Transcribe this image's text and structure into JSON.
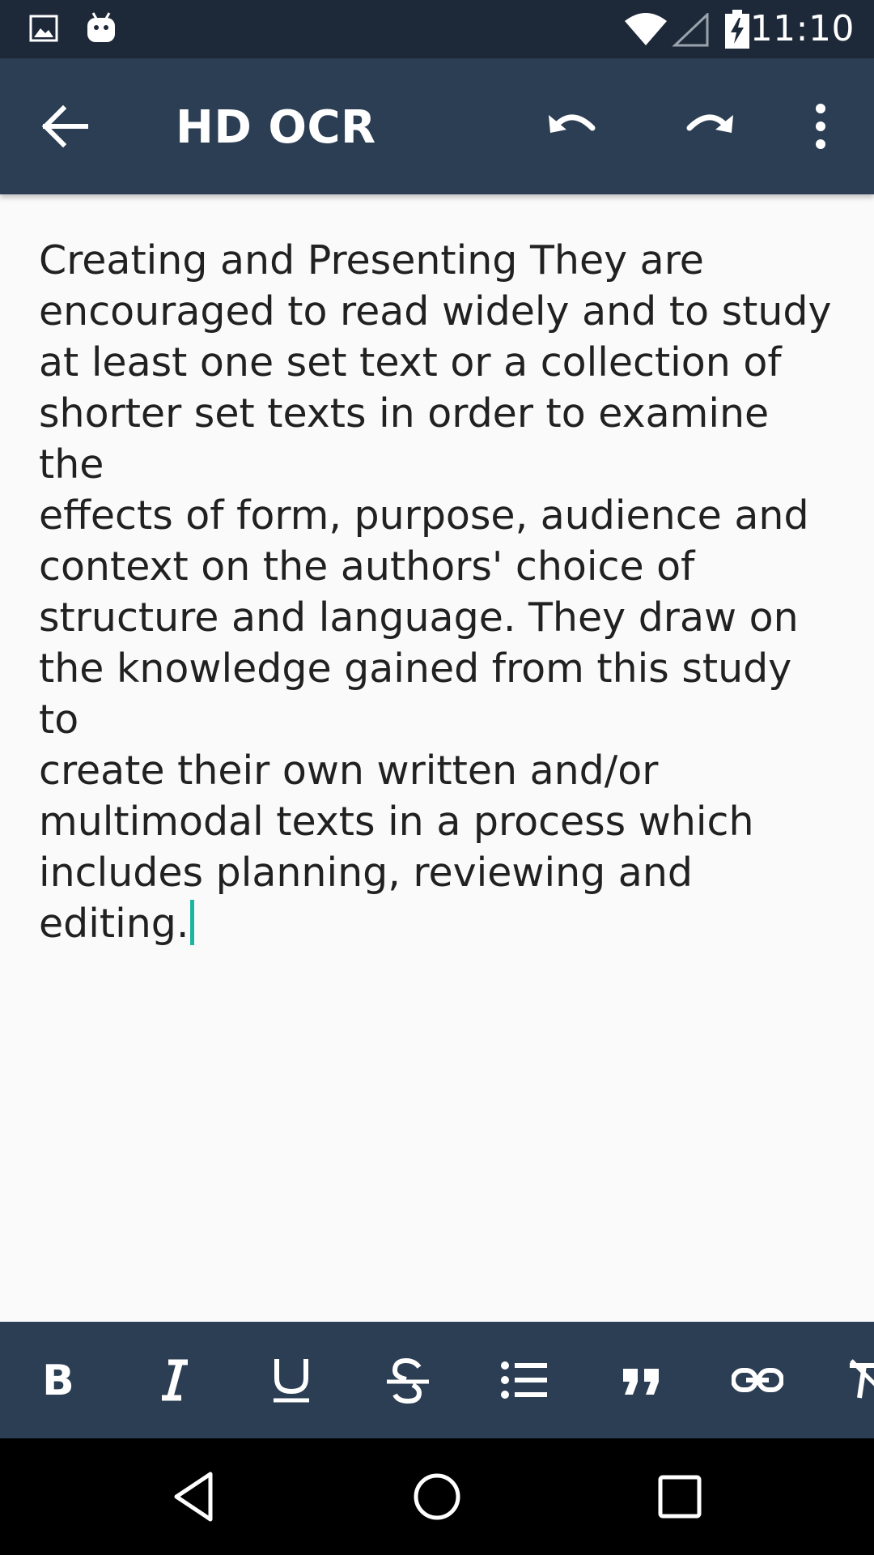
{
  "status_bar": {
    "time": "11:10",
    "icons": [
      "image-notification-icon",
      "android-notification-icon",
      "wifi-icon",
      "cell-signal-icon",
      "battery-charging-icon"
    ]
  },
  "app_bar": {
    "title": "HD OCR",
    "background": "#2C3E53",
    "icons": [
      "back-arrow-icon",
      "undo-icon",
      "redo-icon",
      "more-vert-icon"
    ]
  },
  "editor": {
    "text": "Creating and Presenting They are\nencouraged to read widely and to study\nat least one set text or a collection of\nshorter set texts in order to examine the\neffects of form, purpose, audience and\ncontext on the authors' choice of\nstructure and language. They draw on\nthe knowledge gained from this study to\ncreate their own written and/or\nmultimodal texts in a process which\nincludes planning, reviewing and editing.",
    "cursor_color": "#1DB5A0"
  },
  "format_toolbar": {
    "buttons": [
      "bold-icon",
      "italic-icon",
      "underline-icon",
      "strikethrough-icon",
      "bulleted-list-icon",
      "quote-icon",
      "link-icon",
      "clear-format-icon"
    ]
  },
  "nav_bar": {
    "buttons": [
      "nav-back-icon",
      "nav-home-icon",
      "nav-recents-icon"
    ]
  }
}
